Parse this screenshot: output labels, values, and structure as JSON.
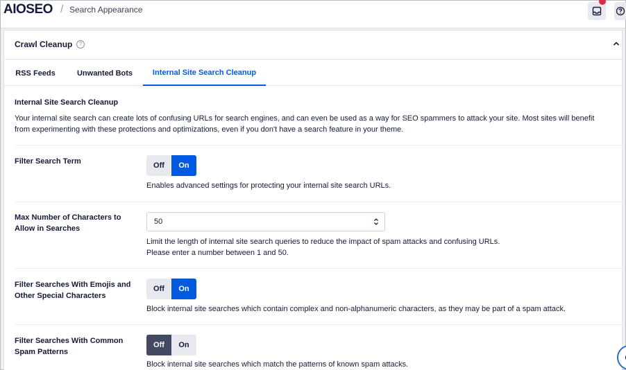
{
  "header": {
    "logo_text_left": "AIO",
    "logo_text_right": "SEO",
    "separator": "/",
    "title": "Search Appearance",
    "inbox_icon": "inbox-icon",
    "help_icon": "help-icon"
  },
  "card": {
    "title": "Crawl Cleanup",
    "help_icon": "question-circle-icon",
    "collapse_icon": "chevron-up-icon"
  },
  "tabs": [
    {
      "label": "RSS Feeds",
      "active": false
    },
    {
      "label": "Unwanted Bots",
      "active": false
    },
    {
      "label": "Internal Site Search Cleanup",
      "active": true
    }
  ],
  "section": {
    "title": "Internal Site Search Cleanup",
    "intro": "Your internal site search can create lots of confusing URLs for search engines, and can even be used as a way for SEO spammers to attack your site. Most sites will benefit from experimenting with these protections and optimizations, even if you don't have a search feature in your theme."
  },
  "settings": {
    "filter_search_term": {
      "label": "Filter Search Term",
      "off_label": "Off",
      "on_label": "On",
      "value": "On",
      "description": "Enables advanced settings for protecting your internal site search URLs."
    },
    "max_chars": {
      "label": "Max Number of Characters to Allow in Searches",
      "value": "50",
      "description_1": "Limit the length of internal site search queries to reduce the impact of spam attacks and confusing URLs.",
      "description_2": "Please enter a number between 1 and 50."
    },
    "filter_emojis": {
      "label": "Filter Searches With Emojis and Other Special Characters",
      "off_label": "Off",
      "on_label": "On",
      "value": "On",
      "description": "Block internal site searches which contain complex and non-alphanumeric characters, as they may be part of a spam attack."
    },
    "filter_spam_patterns": {
      "label": "Filter Searches With Common Spam Patterns",
      "off_label": "Off",
      "on_label": "On",
      "value": "Off",
      "description": "Block internal site searches which match the patterns of known spam attacks."
    }
  },
  "colors": {
    "accent": "#005ae0",
    "dark_toggle": "#434960",
    "text": "#141b38"
  }
}
